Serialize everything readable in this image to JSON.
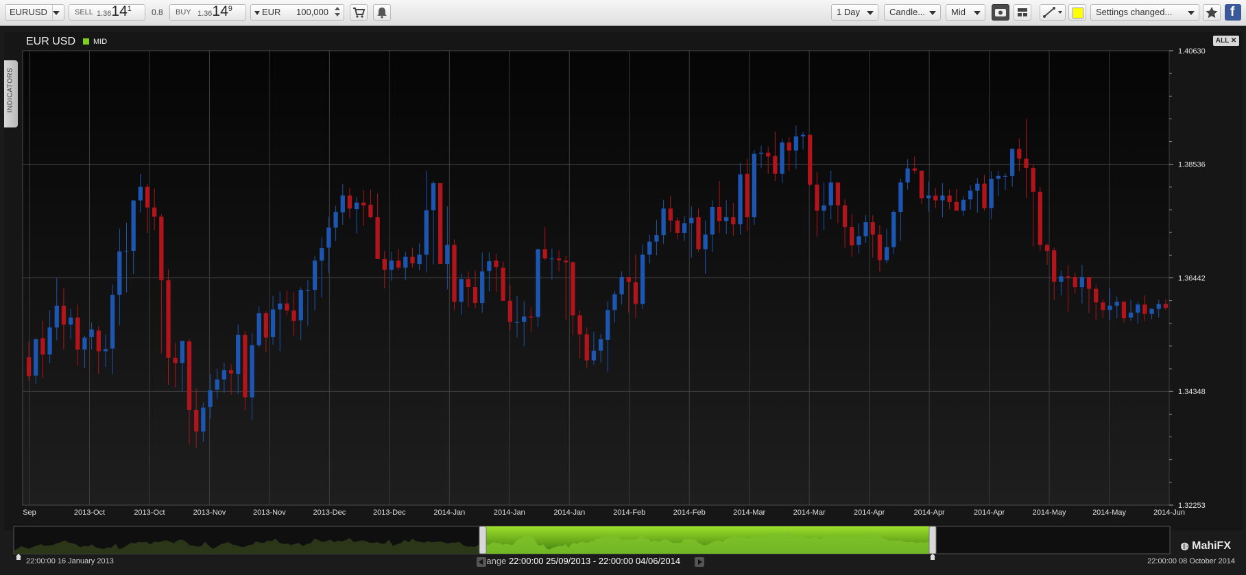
{
  "toolbar": {
    "symbol": "EURUSD",
    "sell_label": "SELL",
    "sell_prefix": "1.36",
    "sell_big": "14",
    "sell_sup": "1",
    "spread": "0.8",
    "buy_label": "BUY",
    "buy_prefix": "1.36",
    "buy_big": "14",
    "buy_sup": "9",
    "currency": "EUR",
    "amount": "100,000",
    "interval": "1 Day",
    "chart_type": "Candle...",
    "price_mode": "Mid",
    "settings": "Settings changed..."
  },
  "chart_header": {
    "pair": "EUR USD",
    "mode": "MID",
    "all_label": "ALL",
    "indicators_label": "INDICATORS"
  },
  "colors": {
    "up": "#1d56b0",
    "down": "#b0151c",
    "mid_badge": "#7fcf1f",
    "navigator": "#6fb01f",
    "background": "#0b0b0b",
    "grid": "#444444"
  },
  "chart_data": {
    "type": "candlestick",
    "title": "EUR USD",
    "ylim": [
      1.32253,
      1.4063
    ],
    "y_ticks": [
      "1.40630",
      "1.38536",
      "1.36442",
      "1.34348",
      "1.32253"
    ],
    "x_ticks": [
      "Sep",
      "2013-Oct",
      "2013-Oct",
      "2013-Nov",
      "2013-Nov",
      "2013-Dec",
      "2013-Dec",
      "2014-Jan",
      "2014-Jan",
      "2014-Jan",
      "2014-Feb",
      "2014-Feb",
      "2014-Mar",
      "2014-Mar",
      "2014-Apr",
      "2014-Apr",
      "2014-Apr",
      "2014-May",
      "2014-May",
      "2014-Jun"
    ],
    "grid": true,
    "candles": [
      [
        1.3498,
        1.3527,
        1.3455,
        1.3463
      ],
      [
        1.3464,
        1.3533,
        1.3449,
        1.3531
      ],
      [
        1.3533,
        1.3565,
        1.3459,
        1.3503
      ],
      [
        1.3503,
        1.3585,
        1.3487,
        1.3553
      ],
      [
        1.3553,
        1.3645,
        1.3529,
        1.3593
      ],
      [
        1.3593,
        1.3625,
        1.3512,
        1.3558
      ],
      [
        1.3558,
        1.3587,
        1.3531,
        1.3571
      ],
      [
        1.3571,
        1.3595,
        1.3482,
        1.3512
      ],
      [
        1.3512,
        1.3538,
        1.3478,
        1.3534
      ],
      [
        1.3535,
        1.3562,
        1.3512,
        1.3549
      ],
      [
        1.3547,
        1.3555,
        1.3467,
        1.3509
      ],
      [
        1.3509,
        1.354,
        1.348,
        1.3513
      ],
      [
        1.3514,
        1.3632,
        1.3467,
        1.3613
      ],
      [
        1.3613,
        1.3735,
        1.3557,
        1.3693
      ],
      [
        1.3693,
        1.3746,
        1.3617,
        1.3693
      ],
      [
        1.3694,
        1.376,
        1.3651,
        1.3787
      ],
      [
        1.3787,
        1.3836,
        1.3765,
        1.3812
      ],
      [
        1.3812,
        1.3818,
        1.3727,
        1.3774
      ],
      [
        1.3774,
        1.3809,
        1.3732,
        1.3757
      ],
      [
        1.3757,
        1.3762,
        1.3505,
        1.364
      ],
      [
        1.364,
        1.366,
        1.3447,
        1.3497
      ],
      [
        1.3497,
        1.3525,
        1.3442,
        1.3487
      ],
      [
        1.3487,
        1.3524,
        1.3435,
        1.3528
      ],
      [
        1.3527,
        1.3532,
        1.3337,
        1.3401
      ],
      [
        1.3401,
        1.3441,
        1.3331,
        1.3361
      ],
      [
        1.3361,
        1.3414,
        1.3342,
        1.3405
      ],
      [
        1.3406,
        1.3467,
        1.3384,
        1.3437
      ],
      [
        1.3438,
        1.3477,
        1.3421,
        1.3457
      ],
      [
        1.3457,
        1.3487,
        1.3432,
        1.3474
      ],
      [
        1.3474,
        1.3485,
        1.3429,
        1.3468
      ],
      [
        1.3467,
        1.3558,
        1.343,
        1.3539
      ],
      [
        1.3539,
        1.3546,
        1.34,
        1.3424
      ],
      [
        1.3424,
        1.3543,
        1.3382,
        1.352
      ],
      [
        1.352,
        1.3592,
        1.3516,
        1.3579
      ],
      [
        1.3579,
        1.3583,
        1.3507,
        1.3534
      ],
      [
        1.3535,
        1.3611,
        1.3521,
        1.3586
      ],
      [
        1.3586,
        1.3619,
        1.3509,
        1.3597
      ],
      [
        1.3597,
        1.3621,
        1.3575,
        1.3584
      ],
      [
        1.3584,
        1.3618,
        1.3538,
        1.3565
      ],
      [
        1.3566,
        1.3627,
        1.353,
        1.3622
      ],
      [
        1.3622,
        1.364,
        1.3556,
        1.3622
      ],
      [
        1.3622,
        1.3685,
        1.3584,
        1.3676
      ],
      [
        1.3676,
        1.3719,
        1.3608,
        1.3699
      ],
      [
        1.37,
        1.3757,
        1.3653,
        1.3737
      ],
      [
        1.3737,
        1.3777,
        1.3712,
        1.3766
      ],
      [
        1.3765,
        1.3817,
        1.3742,
        1.3796
      ],
      [
        1.3796,
        1.381,
        1.3754,
        1.3772
      ],
      [
        1.3771,
        1.3793,
        1.3726,
        1.3783
      ],
      [
        1.3783,
        1.3806,
        1.374,
        1.3778
      ],
      [
        1.3779,
        1.3807,
        1.3754,
        1.3756
      ],
      [
        1.3756,
        1.38,
        1.3683,
        1.3679
      ],
      [
        1.3679,
        1.3694,
        1.3625,
        1.3659
      ],
      [
        1.3659,
        1.3692,
        1.3639,
        1.3676
      ],
      [
        1.3676,
        1.3697,
        1.3658,
        1.3663
      ],
      [
        1.3663,
        1.3692,
        1.364,
        1.3683
      ],
      [
        1.3683,
        1.37,
        1.3663,
        1.3671
      ],
      [
        1.367,
        1.3708,
        1.3658,
        1.3687
      ],
      [
        1.3687,
        1.3841,
        1.3654,
        1.3769
      ],
      [
        1.3769,
        1.3823,
        1.3669,
        1.3819
      ],
      [
        1.3819,
        1.3801,
        1.3675,
        1.367
      ],
      [
        1.367,
        1.3776,
        1.3623,
        1.3705
      ],
      [
        1.3705,
        1.3715,
        1.3585,
        1.36
      ],
      [
        1.36,
        1.3652,
        1.3576,
        1.3642
      ],
      [
        1.3642,
        1.3656,
        1.359,
        1.3627
      ],
      [
        1.3627,
        1.3658,
        1.3588,
        1.3598
      ],
      [
        1.3598,
        1.3691,
        1.358,
        1.3656
      ],
      [
        1.3657,
        1.3691,
        1.3619,
        1.3675
      ],
      [
        1.3676,
        1.3688,
        1.3618,
        1.3664
      ],
      [
        1.3663,
        1.3675,
        1.3617,
        1.3602
      ],
      [
        1.3602,
        1.3631,
        1.3548,
        1.3563
      ],
      [
        1.3563,
        1.3611,
        1.3534,
        1.3563
      ],
      [
        1.3563,
        1.3601,
        1.3518,
        1.3573
      ],
      [
        1.3573,
        1.359,
        1.3544,
        1.3571
      ],
      [
        1.3572,
        1.3698,
        1.3554,
        1.3697
      ],
      [
        1.3697,
        1.3738,
        1.3677,
        1.368
      ],
      [
        1.368,
        1.3698,
        1.3641,
        1.368
      ],
      [
        1.368,
        1.3695,
        1.3656,
        1.3677
      ],
      [
        1.3676,
        1.3685,
        1.3567,
        1.3673
      ],
      [
        1.3673,
        1.3675,
        1.3539,
        1.3575
      ],
      [
        1.3575,
        1.3584,
        1.3496,
        1.354
      ],
      [
        1.354,
        1.3553,
        1.3478,
        1.3492
      ],
      [
        1.3492,
        1.3545,
        1.3484,
        1.351
      ],
      [
        1.351,
        1.3541,
        1.3488,
        1.3531
      ],
      [
        1.353,
        1.3601,
        1.3471,
        1.3585
      ],
      [
        1.3585,
        1.362,
        1.3562,
        1.3614
      ],
      [
        1.3614,
        1.3656,
        1.3595,
        1.3646
      ],
      [
        1.3646,
        1.3646,
        1.358,
        1.3637
      ],
      [
        1.3636,
        1.3687,
        1.357,
        1.3596
      ],
      [
        1.3596,
        1.3706,
        1.3587,
        1.3687
      ],
      [
        1.3687,
        1.3724,
        1.3671,
        1.3711
      ],
      [
        1.3711,
        1.3751,
        1.3686,
        1.3723
      ],
      [
        1.3723,
        1.3788,
        1.3707,
        1.3772
      ],
      [
        1.3772,
        1.3795,
        1.3729,
        1.375
      ],
      [
        1.375,
        1.3756,
        1.3715,
        1.3727
      ],
      [
        1.3727,
        1.3758,
        1.3712,
        1.3745
      ],
      [
        1.3745,
        1.3776,
        1.3682,
        1.3755
      ],
      [
        1.3756,
        1.3772,
        1.3692,
        1.3697
      ],
      [
        1.3697,
        1.375,
        1.3652,
        1.3724
      ],
      [
        1.3724,
        1.3787,
        1.3692,
        1.3775
      ],
      [
        1.3775,
        1.3823,
        1.3727,
        1.3749
      ],
      [
        1.3749,
        1.3788,
        1.3725,
        1.3756
      ],
      [
        1.3756,
        1.3782,
        1.3722,
        1.3743
      ],
      [
        1.3743,
        1.3856,
        1.3724,
        1.3835
      ],
      [
        1.3836,
        1.3864,
        1.3731,
        1.3756
      ],
      [
        1.3756,
        1.388,
        1.3742,
        1.3873
      ],
      [
        1.3873,
        1.3888,
        1.3847,
        1.3875
      ],
      [
        1.3875,
        1.3886,
        1.3836,
        1.3868
      ],
      [
        1.3869,
        1.3914,
        1.3823,
        1.3836
      ],
      [
        1.3836,
        1.3901,
        1.3819,
        1.3894
      ],
      [
        1.3894,
        1.3904,
        1.3841,
        1.3879
      ],
      [
        1.3879,
        1.3925,
        1.3845,
        1.3905
      ],
      [
        1.3905,
        1.3913,
        1.3881,
        1.3908
      ],
      [
        1.3908,
        1.3901,
        1.3814,
        1.3816
      ],
      [
        1.3816,
        1.3839,
        1.372,
        1.3768
      ],
      [
        1.3768,
        1.382,
        1.3732,
        1.3778
      ],
      [
        1.3778,
        1.3842,
        1.3752,
        1.382
      ],
      [
        1.382,
        1.3806,
        1.3745,
        1.3778
      ],
      [
        1.3778,
        1.3789,
        1.37,
        1.3738
      ],
      [
        1.3738,
        1.3762,
        1.3683,
        1.3704
      ],
      [
        1.3705,
        1.3745,
        1.3689,
        1.3721
      ],
      [
        1.3721,
        1.376,
        1.3709,
        1.3747
      ],
      [
        1.3747,
        1.376,
        1.3682,
        1.3724
      ],
      [
        1.3724,
        1.3741,
        1.3656,
        1.3677
      ],
      [
        1.3677,
        1.3735,
        1.3671,
        1.3701
      ],
      [
        1.3701,
        1.3769,
        1.3688,
        1.3766
      ],
      [
        1.3766,
        1.3827,
        1.3712,
        1.382
      ],
      [
        1.382,
        1.3863,
        1.3807,
        1.3846
      ],
      [
        1.3846,
        1.3868,
        1.3837,
        1.3842
      ],
      [
        1.3842,
        1.3838,
        1.3781,
        1.3791
      ],
      [
        1.3791,
        1.3822,
        1.3766,
        1.3796
      ],
      [
        1.3796,
        1.381,
        1.3773,
        1.3787
      ],
      [
        1.3787,
        1.3819,
        1.3756,
        1.3796
      ],
      [
        1.3796,
        1.3807,
        1.3771,
        1.3784
      ],
      [
        1.3784,
        1.3808,
        1.377,
        1.3768
      ],
      [
        1.3768,
        1.3795,
        1.3759,
        1.3788
      ],
      [
        1.3789,
        1.3815,
        1.377,
        1.3805
      ],
      [
        1.3805,
        1.3828,
        1.3764,
        1.3818
      ],
      [
        1.3818,
        1.3834,
        1.3768,
        1.3773
      ],
      [
        1.3773,
        1.3841,
        1.3752,
        1.3827
      ],
      [
        1.3827,
        1.3842,
        1.3795,
        1.3832
      ],
      [
        1.3832,
        1.3837,
        1.3806,
        1.3832
      ],
      [
        1.3832,
        1.3883,
        1.3812,
        1.3882
      ],
      [
        1.3882,
        1.3901,
        1.3841,
        1.3864
      ],
      [
        1.3864,
        1.3937,
        1.3791,
        1.3847
      ],
      [
        1.3847,
        1.3854,
        1.3702,
        1.3803
      ],
      [
        1.3803,
        1.3812,
        1.3694,
        1.3705
      ],
      [
        1.3705,
        1.3707,
        1.3668,
        1.3694
      ],
      [
        1.3695,
        1.37,
        1.3604,
        1.3637
      ],
      [
        1.3637,
        1.3658,
        1.3612,
        1.3647
      ],
      [
        1.3647,
        1.3668,
        1.3582,
        1.3645
      ],
      [
        1.3646,
        1.3654,
        1.3615,
        1.3627
      ],
      [
        1.3627,
        1.3668,
        1.3597,
        1.3646
      ],
      [
        1.3646,
        1.3638,
        1.3579,
        1.3624
      ],
      [
        1.3624,
        1.3631,
        1.3566,
        1.3599
      ],
      [
        1.3599,
        1.3605,
        1.357,
        1.3585
      ],
      [
        1.3585,
        1.3625,
        1.3567,
        1.3593
      ],
      [
        1.3593,
        1.361,
        1.357,
        1.36
      ],
      [
        1.36,
        1.3602,
        1.3562,
        1.357
      ],
      [
        1.3571,
        1.3603,
        1.3565,
        1.358
      ],
      [
        1.358,
        1.36,
        1.356,
        1.3595
      ],
      [
        1.3595,
        1.3612,
        1.3565,
        1.3578
      ],
      [
        1.3578,
        1.3588,
        1.3568,
        1.3587
      ],
      [
        1.3587,
        1.3604,
        1.3571,
        1.3596
      ],
      [
        1.3596,
        1.3605,
        1.3585,
        1.3589
      ]
    ]
  },
  "navigator": {
    "range_label": "Range",
    "range_value": "22:00:00 25/09/2013 - 22:00:00 04/06/2014",
    "start_date": "22:00:00 16 January 2013",
    "end_date": "22:00:00 08 October 2014",
    "brand": "MahiFX"
  }
}
